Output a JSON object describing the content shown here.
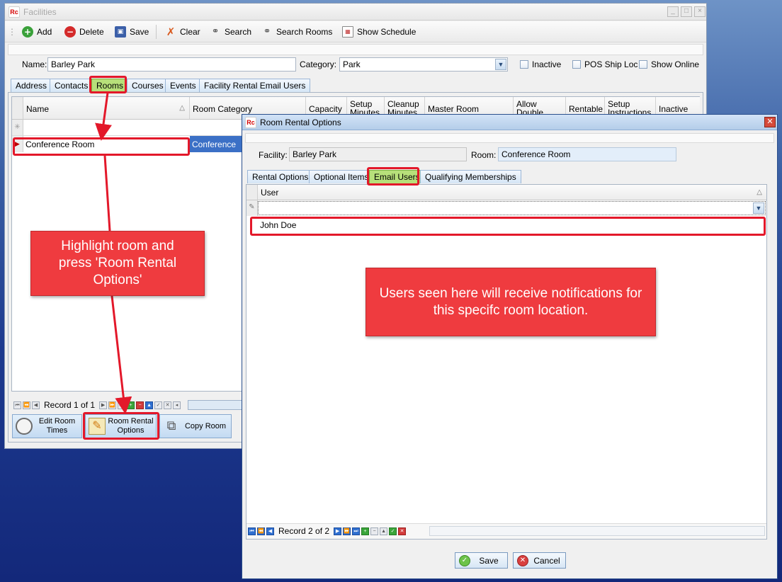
{
  "facilities": {
    "title": "Facilities",
    "toolbar": {
      "add": "Add",
      "delete": "Delete",
      "save": "Save",
      "clear": "Clear",
      "search": "Search",
      "search_rooms": "Search Rooms",
      "show_schedule": "Show Schedule"
    },
    "name_label": "Name:",
    "name_value": "Barley Park",
    "category_label": "Category:",
    "category_value": "Park",
    "checkboxes": {
      "inactive": "Inactive",
      "pos_ship_loc": "POS Ship Loc",
      "show_online": "Show Online"
    },
    "tabs": [
      "Address",
      "Contacts",
      "Rooms",
      "Courses",
      "Events",
      "Facility Rental Email Users"
    ],
    "active_tab": "Rooms",
    "grid": {
      "columns": [
        "Name",
        "Room Category",
        "Capacity",
        "Setup Minutes",
        "Cleanup Minutes",
        "Master Room",
        "Allow Double Booking",
        "Rentable",
        "Setup Instructions",
        "Inactive"
      ],
      "rows": [
        {
          "name": "Conference Room",
          "category": "Conference"
        }
      ]
    },
    "record_nav": "Record 1 of 1",
    "buttons": {
      "edit_room_times": "Edit Room Times",
      "room_rental_options": "Room Rental Options",
      "copy_room": "Copy Room"
    }
  },
  "room_rental": {
    "title": "Room Rental Options",
    "facility_label": "Facility:",
    "facility_value": "Barley Park",
    "room_label": "Room:",
    "room_value": "Conference Room",
    "tabs": [
      "Rental Options",
      "Optional Items",
      "Email Users",
      "Qualifying Memberships"
    ],
    "active_tab": "Email Users",
    "grid": {
      "column": "User",
      "rows": [
        "John Doe"
      ]
    },
    "record_nav": "Record 2 of 2",
    "save": "Save",
    "cancel": "Cancel"
  },
  "annotations": {
    "left": "Highlight room and press 'Room Rental Options'",
    "right": "Users seen here will receive notifications for this specifc room location."
  },
  "colors": {
    "highlight": "#e3182a",
    "callout": "#ef3b3f",
    "active_tab": "#b7e07a"
  }
}
